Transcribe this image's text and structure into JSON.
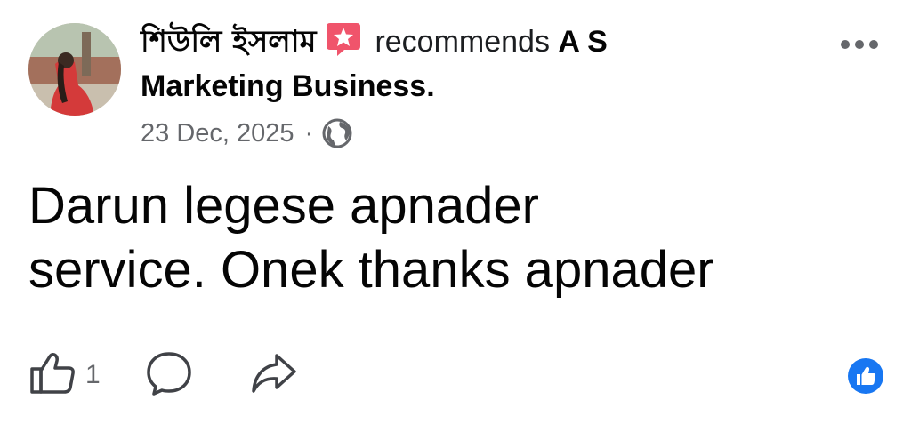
{
  "post": {
    "author_name": "শিউলি ইসলাম",
    "action_text": "recommends",
    "page_name_line1": "A S",
    "page_name_line2": "Marketing Business.",
    "date": "23 Dec, 2025",
    "separator": "·",
    "audience_icon": "globe-icon",
    "body_line1": "Darun legese apnader",
    "body_line2": "service. Onek thanks apnader"
  },
  "actions": {
    "like_icon": "thumbs-up-outline-icon",
    "like_count": "1",
    "comment_icon": "comment-bubble-icon",
    "share_icon": "share-arrow-icon",
    "more_icon": "more-horizontal-icon"
  },
  "reactions": {
    "badge_icon": "like-reaction-icon"
  },
  "colors": {
    "recommend_badge": "#f0546b",
    "like_blue": "#1877f2",
    "secondary_text": "#65676b",
    "primary_text": "#050505"
  }
}
